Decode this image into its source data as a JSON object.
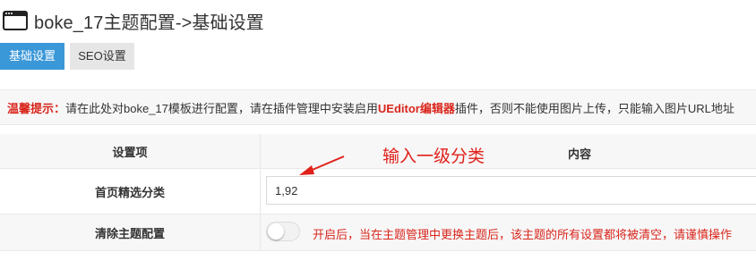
{
  "header": {
    "title": "boke_17主题配置->基础设置",
    "icon": "browser-window-icon"
  },
  "tabs": [
    {
      "label": "基础设置",
      "active": true
    },
    {
      "label": "SEO设置",
      "active": false
    }
  ],
  "notice": {
    "label": "温馨提示：",
    "text_before": "请在此处对boke_17模板进行配置，请在插件管理中安装启用",
    "highlight": "UEditor编辑器",
    "text_after": "插件，否则不能使用图片上传，只能输入图片URL地址"
  },
  "table": {
    "header": {
      "col1": "设置项",
      "col2": "内容"
    },
    "rows": [
      {
        "label": "首页精选分类",
        "value": "1,92"
      },
      {
        "label": "清除主题配置",
        "toggle_on": false,
        "hint": "开启后，当在主题管理中更换主题后，该主题的所有设置都将被清空，请谨慎操作"
      }
    ]
  },
  "annotation": {
    "text": "输入一级分类",
    "color": "#e0211a"
  },
  "colors": {
    "accent": "#3a97d8",
    "warning": "#d9261c"
  }
}
